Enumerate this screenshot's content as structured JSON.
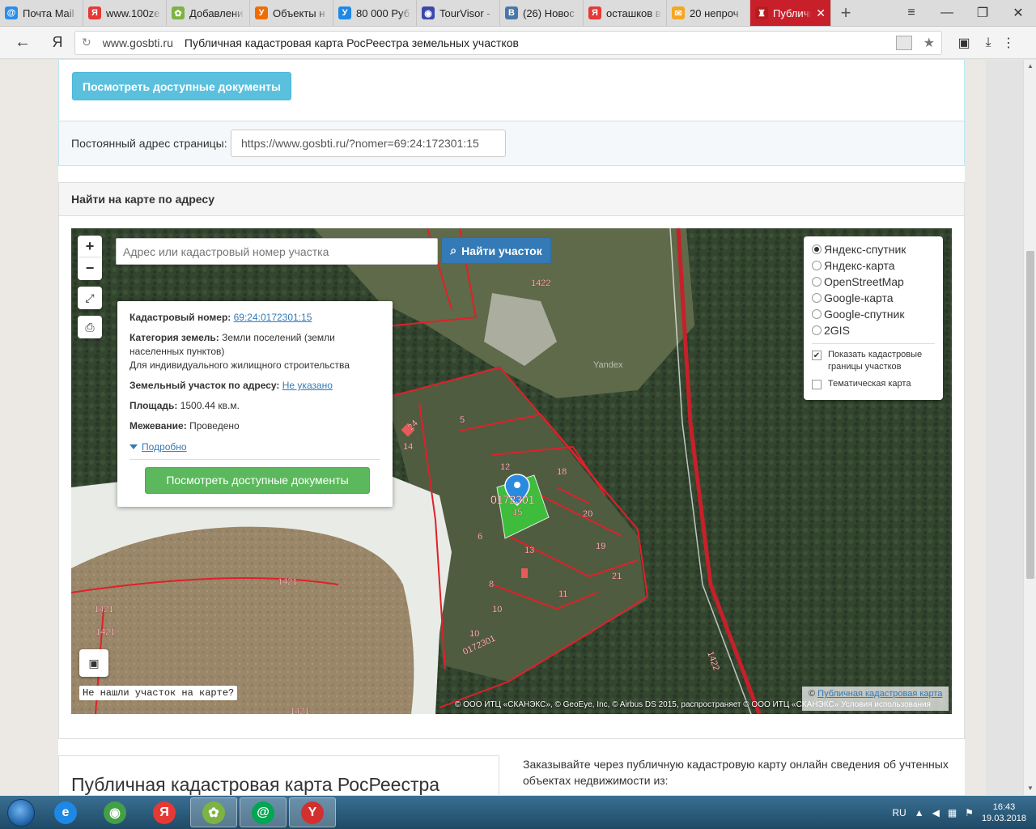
{
  "browser": {
    "tabs": [
      {
        "label": "Почта Mail",
        "icon": "mail-icon",
        "color": "#2b8ee8",
        "glyph": "@"
      },
      {
        "label": "www.100ze",
        "icon": "yandex-icon",
        "color": "#e53935",
        "glyph": "Я"
      },
      {
        "label": "Добавлени",
        "icon": "plus-square-icon",
        "color": "#7cb342",
        "glyph": "✿"
      },
      {
        "label": "Объекты н",
        "icon": "yandex-realty-icon",
        "color": "#ef6c00",
        "glyph": "У"
      },
      {
        "label": "80 000 Руб",
        "icon": "yandex-realty-icon",
        "color": "#1e88e5",
        "glyph": "У"
      },
      {
        "label": "TourVisor -",
        "icon": "eye-icon",
        "color": "#3949ab",
        "glyph": "◉"
      },
      {
        "label": "(26) Новос",
        "icon": "vk-icon",
        "color": "#4a76a8",
        "glyph": "В"
      },
      {
        "label": "осташков в",
        "icon": "yandex-icon",
        "color": "#e53935",
        "glyph": "Я"
      },
      {
        "label": "20 непроч",
        "icon": "envelope-icon",
        "color": "#f5a623",
        "glyph": "✉"
      },
      {
        "label": "Публичн",
        "icon": "cadastre-icon",
        "color": "#b71c1c",
        "glyph": "♜",
        "active": true
      }
    ],
    "new_tab": "+",
    "window": {
      "menu": "≡",
      "minimize": "—",
      "restore": "❐",
      "close": "✕"
    },
    "address": {
      "back": "←",
      "yandex": "Я",
      "host": "www.gosbti.ru",
      "title": "Публичная кадастровая карта РосРеестра земельных участков"
    }
  },
  "page": {
    "docs_button": "Посмотреть доступные документы",
    "permalink_label": "Постоянный адрес страницы:",
    "permalink_value": "https://www.gosbti.ru/?nomer=69:24:172301:15",
    "find_panel_title": "Найти на карте по адресу",
    "map": {
      "zoom_in": "+",
      "zoom_out": "−",
      "search_placeholder": "Адрес или кадастровый номер участка",
      "search_button": "Найти участок",
      "popup": {
        "cadastral_label": "Кадастровый номер:",
        "cadastral_value": "69:24:0172301:15",
        "category_label": "Категория земель:",
        "category_value": "Земли поселений (земли населенных пунктов)",
        "usage": "Для индивидуального жилищного строительства",
        "address_label": "Земельный участок по адресу:",
        "address_value": "Не указано",
        "area_label": "Площадь:",
        "area_value": "1500.44 кв.м.",
        "survey_label": "Межевание:",
        "survey_value": "Проведено",
        "more": "Подробно",
        "docs_button": "Посмотреть доступные документы"
      },
      "layers": {
        "base": [
          {
            "label": "Яндекс-спутник",
            "selected": true
          },
          {
            "label": "Яндекс-карта",
            "selected": false
          },
          {
            "label": "OpenStreetMap",
            "selected": false
          },
          {
            "label": "Google-карта",
            "selected": false
          },
          {
            "label": "Google-спутник",
            "selected": false
          },
          {
            "label": "2GIS",
            "selected": false
          }
        ],
        "overlays": [
          {
            "label": "Показать кадастровые границы участков",
            "checked": true
          },
          {
            "label": "Тематическая карта",
            "checked": false
          }
        ]
      },
      "not_found": "Не нашли участок на карте?",
      "attribution": "© ООО ИТЦ «СКАНЭКС», © GeoEye, Inc, © Airbus DS 2015, распространяет © ООО ИТЦ «СКАНЭКС» Условия использования",
      "attribution2_prefix": "©",
      "attribution2_link": "Публичная кадастровая карта",
      "watermark": "Yandex",
      "labels": [
        {
          "text": "1422"
        },
        {
          "text": "24"
        },
        {
          "text": "5"
        },
        {
          "text": "14"
        },
        {
          "text": "12"
        },
        {
          "text": "18"
        },
        {
          "text": "0172301"
        },
        {
          "text": "15"
        },
        {
          "text": "20"
        },
        {
          "text": "6"
        },
        {
          "text": "13"
        },
        {
          "text": "19"
        },
        {
          "text": "8"
        },
        {
          "text": "21"
        },
        {
          "text": "11"
        },
        {
          "text": "10"
        },
        {
          "text": "10"
        },
        {
          "text": "0172301"
        },
        {
          "text": "1421"
        },
        {
          "text": "1421"
        },
        {
          "text": "1421"
        },
        {
          "text": "1421"
        },
        {
          "text": "1422"
        }
      ]
    },
    "lower_title": "Публичная кадастровая карта РосРеестра",
    "lower_text": "Заказывайте через публичную кадастровую карту онлайн сведения об учтенных объектах недвижимости из:"
  },
  "taskbar": {
    "apps": [
      {
        "name": "ie-icon",
        "glyph": "e",
        "color": "#1e88e5"
      },
      {
        "name": "chrome-icon",
        "glyph": "◉",
        "color": "#43a047"
      },
      {
        "name": "yandex-browser-icon",
        "glyph": "Я",
        "color": "#e53935"
      },
      {
        "name": "icq-icon",
        "glyph": "✿",
        "color": "#7cb342"
      },
      {
        "name": "mail-agent-icon",
        "glyph": "@",
        "color": "#00a651"
      },
      {
        "name": "yandex-app-icon",
        "glyph": "Y",
        "color": "#d32f2f"
      }
    ],
    "lang": "RU",
    "time": "16:43",
    "date": "19.03.2018"
  }
}
